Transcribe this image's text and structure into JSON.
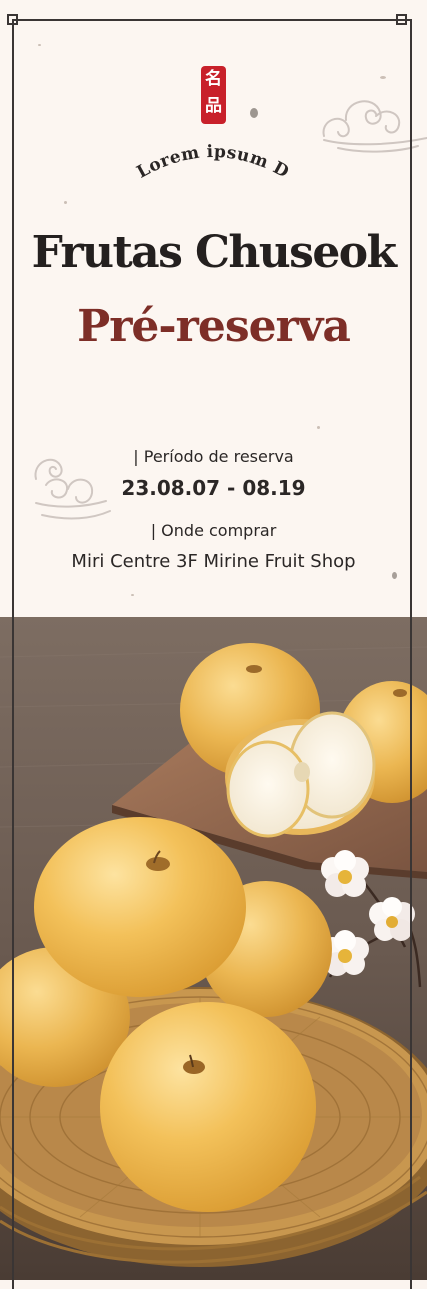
{
  "seal": {
    "glyph_top": "名",
    "glyph_bottom": "品"
  },
  "brand": {
    "arc_text": "Lorem ipsum D"
  },
  "headline": {
    "title": "Frutas Chuseok",
    "subtitle": "Pré-reserva"
  },
  "reservation": {
    "period_label": "| Período de reserva",
    "period_value": "23.08.07 - 08.19",
    "place_label": "| Onde comprar",
    "place_value": "Miri Centre 3F Mirine Fruit Shop"
  },
  "colors": {
    "background": "#fcf6f1",
    "title": "#24201f",
    "accent": "#7d2e27",
    "seal": "#c8202a",
    "frame": "#3a3534",
    "table": "#6e5d52",
    "pear": "#f0b94c",
    "basket": "#b98a48"
  },
  "icons": [
    "seal-stamp-icon",
    "cloud-icon"
  ],
  "image": {
    "subject": "Asian pears in a bamboo basket with white blossoms"
  }
}
